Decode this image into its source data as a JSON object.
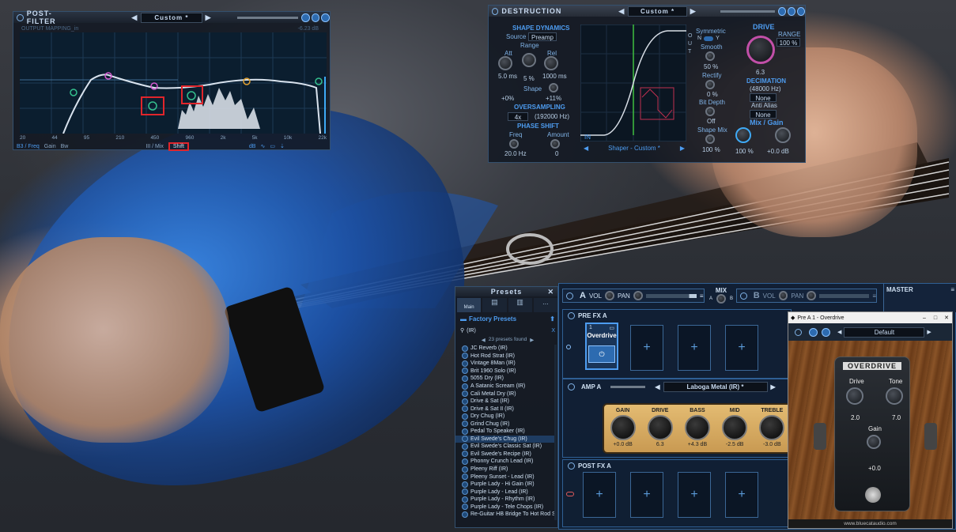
{
  "post_filter": {
    "title": "POST-FILTER",
    "preset": "Custom *",
    "sub_left": "OUTPUT MAPPING_in",
    "sub_right": "-6.23 dB",
    "freq_labels": [
      "20",
      "44",
      "95",
      "210",
      "450",
      "960",
      "2k",
      "5k",
      "10k",
      "22k"
    ],
    "footer": {
      "band": "B3 / Freq",
      "gain": "Gain",
      "bw": "Bw",
      "mix": "III / Mix",
      "shift": "Shift"
    }
  },
  "destruction": {
    "title": "DESTRUCTION",
    "preset": "Custom *",
    "shape_dynamics": {
      "header": "SHAPE DYNAMICS",
      "source_label": "Source",
      "source_value": "Preamp",
      "range_label": "Range",
      "att_label": "Att",
      "rel_label": "Rel",
      "att_value": "5.0 ms",
      "range_value": "5 %",
      "rel_value": "1000 ms",
      "shape_label": "Shape",
      "pct_left": "+0%",
      "pct_right": "+11%"
    },
    "oversampling": {
      "header": "OVERSAMPLING",
      "value": "4x",
      "rate": "(192000 Hz)"
    },
    "phase_shift": {
      "header": "PHASE SHIFT",
      "freq_label": "Freq",
      "amount_label": "Amount",
      "freq_value": "20.0 Hz",
      "amount_value": "0"
    },
    "graph": {
      "in_label": "IN",
      "shaper_label": "Shaper - Custom *",
      "side_letters": [
        "O",
        "U",
        "T"
      ]
    },
    "right_col": {
      "symmetric": "Symmetric",
      "n": "N",
      "y": "Y",
      "smooth": "Smooth",
      "smooth_value": "50 %",
      "rectify": "Rectify",
      "rectify_value": "0 %",
      "bit_depth": "Bit Depth",
      "bit_depth_value": "Off",
      "shape_mix": "Shape Mix",
      "shape_mix_value": "100 %"
    },
    "drive": {
      "header": "DRIVE",
      "range_label": "RANGE",
      "range_value": "100 %",
      "value": "6.3"
    },
    "decimation": {
      "header": "DECIMATION",
      "rate": "(48000 Hz)",
      "none1": "None",
      "anti_alias": "Anti Alias",
      "none2": "None"
    },
    "mix_gain": {
      "header": "Mix / Gain",
      "mix_value": "100 %",
      "gain_value": "+0.0 dB"
    }
  },
  "presets": {
    "title": "Presets",
    "tabs": [
      "Main",
      "",
      "",
      "..."
    ],
    "folder": "Factory Presets",
    "search": "(IR)",
    "clear": "X",
    "found": "23 presets found",
    "items": [
      "JC Reverb (IR)",
      "Hot Rod Strat (IR)",
      "Vintage 8Man (IR)",
      "Brit 1960 Solo (IR)",
      "5055 Dry (IR)",
      "A Satanic Scream (IR)",
      "Cali Metal Dry (IR)",
      "Drive & Sat (IR)",
      "Drive & Sat II (IR)",
      "Dry Chug (IR)",
      "Grind Chug (IR)",
      "Pedal To Speaker (IR)",
      "Evil Swede's Chug (IR)",
      "Evil Swede's Classic Sat (IR)",
      "Evil Swede's Recipe (IR)",
      "Phonny Crunch Lead (IR)",
      "Pleeny Riff (IR)",
      "Pleeny Sunset - Lead (IR)",
      "Purple Lady - Hi Gain (IR)",
      "Purple Lady - Lead (IR)",
      "Purple Lady - Rhythm (IR)",
      "Purple Lady - Tele Chops (IR)",
      "Re-Guitar HB Bridge To Hot Rod Strat (IR)"
    ],
    "selected_index": 12
  },
  "rack": {
    "chain_a": {
      "letter": "A",
      "vol": "VOL",
      "pan": "PAN"
    },
    "mix": {
      "label": "MIX",
      "a": "A",
      "b": "B"
    },
    "chain_b": {
      "letter": "B",
      "vol": "VOL",
      "pan": "PAN"
    },
    "master": "MASTER",
    "pre_fx": {
      "title": "PRE FX A",
      "slot_number": "1",
      "slot_name": "Overdrive"
    },
    "amp": {
      "title": "AMP A",
      "model": "Laboga Metal (IR) *",
      "knobs": [
        {
          "label": "GAIN",
          "value": "+0.0 dB"
        },
        {
          "label": "DRIVE",
          "value": "6.3"
        },
        {
          "label": "BASS",
          "value": "+4.3 dB"
        },
        {
          "label": "MID",
          "value": "-2.5 dB"
        },
        {
          "label": "TREBLE",
          "value": "-3.0 dB"
        }
      ]
    },
    "post_fx": {
      "title": "POST FX A"
    },
    "plus": "+"
  },
  "overdrive_window": {
    "title": "Pre A 1 - Overdrive",
    "preset": "Default",
    "brand": "OVERDRIVE",
    "drive_label": "Drive",
    "drive_value": "2.0",
    "tone_label": "Tone",
    "tone_value": "7.0",
    "gain_label": "Gain",
    "gain_value": "+0.0",
    "footer": "www.bluecataudio.com",
    "window_buttons": [
      "–",
      "□",
      "✕"
    ]
  },
  "colors": {
    "accent": "#4d9cf0",
    "eq_curve": "#c9d6e4",
    "amp_panel": "#d9b16a",
    "wood": "#7a4a22",
    "highlight_box": "#e0252b"
  }
}
